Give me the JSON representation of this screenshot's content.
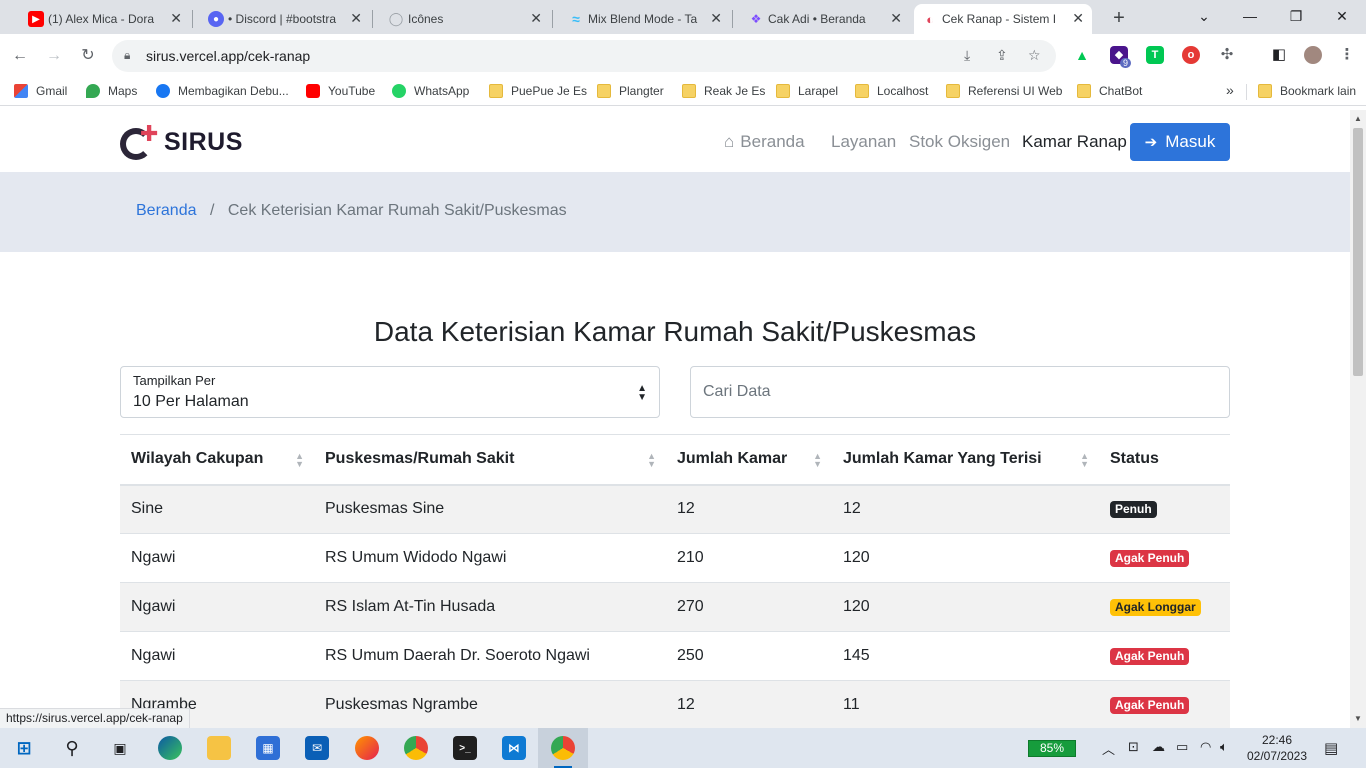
{
  "browser": {
    "tabs": [
      {
        "title": "(1) Alex Mica - Dora",
        "icon": "youtube-icon",
        "color": "#ff0000",
        "active": false
      },
      {
        "title": "• Discord | #bootstra",
        "icon": "discord-icon",
        "color": "#5865f2",
        "active": false
      },
      {
        "title": "Icônes",
        "icon": "icones-icon",
        "color": "#9aa0a6",
        "active": false
      },
      {
        "title": "Mix Blend Mode - Ta",
        "icon": "tailwind-icon",
        "color": "#38bdf8",
        "active": false
      },
      {
        "title": "Cak Adi • Beranda",
        "icon": "cak-adi-icon",
        "color": "#7c4dff",
        "active": false
      },
      {
        "title": "Cek Ranap - Sistem I",
        "icon": "sirus-icon",
        "color": "#e0445a",
        "active": true
      }
    ],
    "new_tab": "+",
    "url": "sirus.vercel.app/cek-ranap",
    "bookmarks": [
      {
        "label": "Gmail",
        "icon": "gmail-icon"
      },
      {
        "label": "Maps",
        "icon": "maps-icon"
      },
      {
        "label": "Membagikan Debu...",
        "icon": "facebook-icon"
      },
      {
        "label": "YouTube",
        "icon": "youtube-icon"
      },
      {
        "label": "WhatsApp",
        "icon": "whatsapp-icon"
      },
      {
        "label": "PuePue Je Es",
        "icon": "folder-icon"
      },
      {
        "label": "Plangter",
        "icon": "folder-icon"
      },
      {
        "label": "Reak Je Es",
        "icon": "folder-icon"
      },
      {
        "label": "Larapel",
        "icon": "folder-icon"
      },
      {
        "label": "Localhost",
        "icon": "folder-icon"
      },
      {
        "label": "Referensi UI Web",
        "icon": "folder-icon"
      },
      {
        "label": "ChatBot",
        "icon": "folder-icon"
      }
    ],
    "bookmarks_overflow": "»",
    "other_bookmarks": "Bookmark lain",
    "extension_badge": "9",
    "status_url": "https://sirus.vercel.app/cek-ranap"
  },
  "site": {
    "brand": "SIRUS",
    "nav": {
      "home": "Beranda",
      "layanan": "Layanan",
      "stok": "Stok Oksigen",
      "kamar": "Kamar Ranap",
      "login": "Masuk"
    },
    "breadcrumb": {
      "home": "Beranda",
      "separator": "/",
      "current": "Cek Keterisian Kamar Rumah Sakit/Puskesmas"
    },
    "title": "Data Keterisian Kamar Rumah Sakit/Puskesmas",
    "per_page": {
      "label": "Tampilkan Per",
      "value": "10 Per Halaman"
    },
    "search": {
      "placeholder": "Cari Data"
    },
    "table": {
      "headers": [
        "Wilayah Cakupan",
        "Puskesmas/Rumah Sakit",
        "Jumlah Kamar",
        "Jumlah Kamar Yang Terisi",
        "Status"
      ],
      "rows": [
        {
          "wilayah": "Sine",
          "faskes": "Puskesmas Sine",
          "jumlah": "12",
          "terisi": "12",
          "status": "Penuh"
        },
        {
          "wilayah": "Ngawi",
          "faskes": "RS Umum Widodo Ngawi",
          "jumlah": "210",
          "terisi": "120",
          "status": "Agak Penuh"
        },
        {
          "wilayah": "Ngawi",
          "faskes": "RS Islam At-Tin Husada",
          "jumlah": "270",
          "terisi": "120",
          "status": "Agak Longgar"
        },
        {
          "wilayah": "Ngawi",
          "faskes": "RS Umum Daerah Dr. Soeroto Ngawi",
          "jumlah": "250",
          "terisi": "145",
          "status": "Agak Penuh"
        },
        {
          "wilayah": "Ngrambe",
          "faskes": "Puskesmas Ngrambe",
          "jumlah": "12",
          "terisi": "11",
          "status": "Agak Penuh"
        }
      ]
    },
    "status_colors": {
      "Penuh": "#212529",
      "Agak Penuh": "#dc3545",
      "Agak Longgar": "#ffc107"
    },
    "accent": "#2d74da"
  },
  "taskbar": {
    "battery": "85%",
    "time": "22:46",
    "date": "02/07/2023"
  }
}
